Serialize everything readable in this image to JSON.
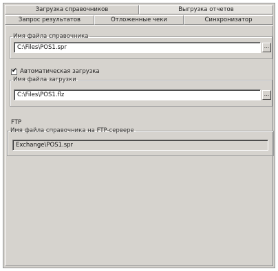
{
  "tabs_row1": [
    {
      "label": "Загрузка справочников",
      "selected": false
    },
    {
      "label": "Выгрузка отчетов",
      "selected": true
    }
  ],
  "tabs_row2": [
    {
      "label": "Запрос результатов"
    },
    {
      "label": "Отложенные чеки"
    },
    {
      "label": "Синхронизатор"
    }
  ],
  "directory_group": {
    "legend": "Имя файла справочника",
    "value": "C:\\Files\\POS1.spr",
    "browse_label": "..."
  },
  "auto_load": {
    "label": "Автоматическая загрузка",
    "checked": true
  },
  "load_group": {
    "legend": "Имя файла загрузки",
    "value": "C:\\Files\\POS1.flz",
    "browse_label": "..."
  },
  "ftp": {
    "section_label": "FTP",
    "legend": "Имя файла справочника на FTP-сервере",
    "value": "Exchange\\POS1.spr"
  }
}
